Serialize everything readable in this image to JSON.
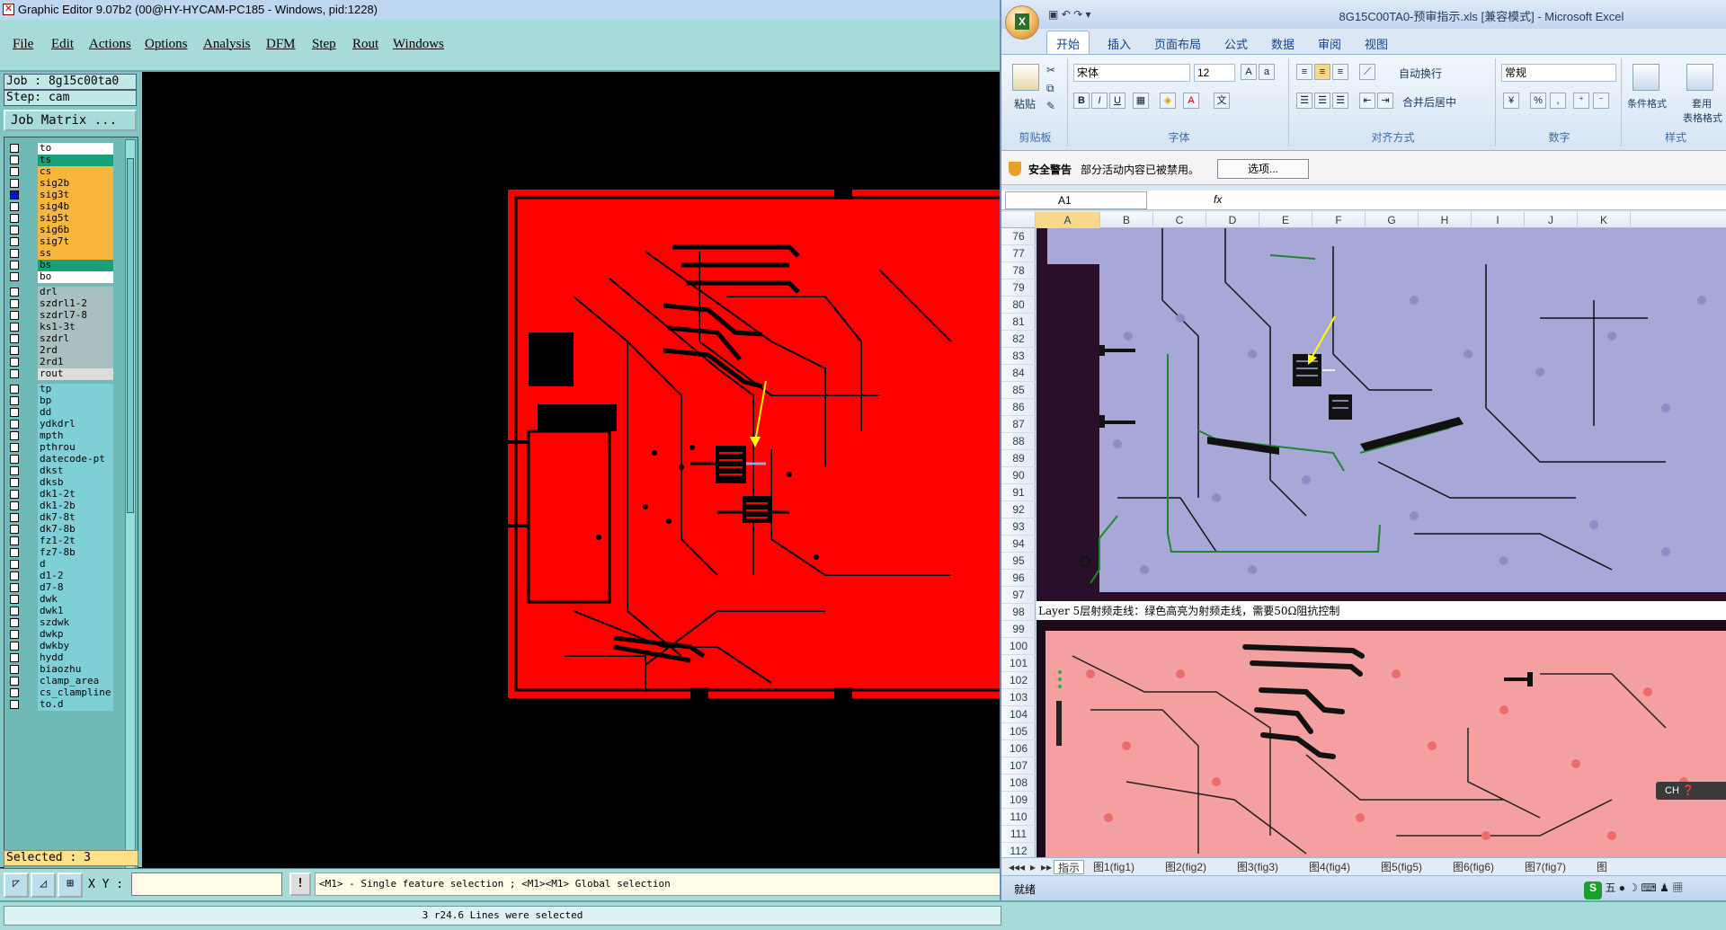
{
  "genesis": {
    "title": "Graphic Editor 9.07b2 (00@HY-HYCAM-PC185 - Windows, pid:1228)",
    "menu": [
      "File",
      "Edit",
      "Actions",
      "Options",
      "Analysis",
      "DFM",
      "Step",
      "Rout",
      "Windows"
    ],
    "job": "Job : 8g15c00ta0",
    "step": "Step: cam",
    "job_matrix": "Job Matrix ...",
    "layers_signal": [
      {
        "name": "to",
        "color": "#ffffff",
        "checked": false
      },
      {
        "name": "ts",
        "color": "#17a07a",
        "checked": false
      },
      {
        "name": "cs",
        "color": "#f6b73c",
        "checked": false
      },
      {
        "name": "sig2b",
        "color": "#f6b73c",
        "checked": false
      },
      {
        "name": "sig3t",
        "color": "#f6b73c",
        "checked": true
      },
      {
        "name": "sig4b",
        "color": "#f6b73c",
        "checked": false
      },
      {
        "name": "sig5t",
        "color": "#f6b73c",
        "checked": false
      },
      {
        "name": "sig6b",
        "color": "#f6b73c",
        "checked": false
      },
      {
        "name": "sig7t",
        "color": "#f6b73c",
        "checked": false
      },
      {
        "name": "ss",
        "color": "#f6b73c",
        "checked": false
      },
      {
        "name": "bs",
        "color": "#17a07a",
        "checked": false
      },
      {
        "name": "bo",
        "color": "#ffffff",
        "checked": false
      }
    ],
    "layers_drill": [
      "drl",
      "szdrl1-2",
      "szdrl7-8",
      "ks1-3t",
      "szdrl",
      "2rd",
      "2rd1",
      "rout"
    ],
    "layers_misc": [
      "tp",
      "bp",
      "dd",
      "ydkdrl",
      "mpth",
      "pthrou",
      "datecode-pt",
      "dkst",
      "dksb",
      "dk1-2t",
      "dk1-2b",
      "dk7-8t",
      "dk7-8b",
      "fz1-2t",
      "fz7-8b",
      "d",
      "d1-2",
      "d7-8",
      "dwk",
      "dwk1",
      "szdwk",
      "dwkp",
      "dwkby",
      "hydd",
      "biaozhu",
      "clamp_area",
      "cs_clampline",
      "to.d"
    ],
    "selected": "Selected : 3",
    "xy_label": "X Y :",
    "hint": "<M1> - Single feature selection ; <M1><M1> Global selection",
    "status": "3 r24.6 Lines were selected",
    "hint_icon": "!",
    "colors": {
      "board": "#ff0000",
      "highlight": "#ffff00",
      "bg": "#000000",
      "panel": "#7fc6c4"
    }
  },
  "excel": {
    "doc_title": "8G15C00TA0-预审指示.xls [兼容模式] - Microsoft Excel",
    "ribbon_tabs": [
      "开始",
      "插入",
      "页面布局",
      "公式",
      "数据",
      "审阅",
      "视图"
    ],
    "active_tab": "开始",
    "groups": {
      "clipboard": {
        "label": "剪贴板",
        "paste": "粘贴"
      },
      "font": {
        "label": "字体",
        "name": "宋体",
        "size": "12",
        "bold": "B",
        "italic": "I",
        "underline": "U"
      },
      "align": {
        "label": "对齐方式",
        "wrap": "自动换行",
        "merge": "合并后居中"
      },
      "number": {
        "label": "数字",
        "format": "常规",
        "percent": "%",
        "comma": ","
      },
      "styles": {
        "label": "样式",
        "cond": "条件格式",
        "table": "套用",
        "table2": "表格格式"
      }
    },
    "security": {
      "title": "安全警告",
      "message": "部分活动内容已被禁用。",
      "options": "选项..."
    },
    "namebox": "A1",
    "fx": "fx",
    "columns": [
      "A",
      "B",
      "C",
      "D",
      "E",
      "F",
      "G",
      "H",
      "I",
      "J",
      "K"
    ],
    "rows": [
      "76",
      "77",
      "78",
      "79",
      "80",
      "81",
      "82",
      "83",
      "84",
      "85",
      "86",
      "87",
      "88",
      "89",
      "90",
      "91",
      "92",
      "93",
      "94",
      "95",
      "96",
      "97",
      "98",
      "99",
      "100",
      "101",
      "102",
      "103",
      "104",
      "105",
      "106",
      "107",
      "108",
      "109",
      "110",
      "111",
      "112"
    ],
    "caption": "Layer 5层射频走线：绿色高亮为射频走线，需要50Ω阻抗控制",
    "sheets": [
      "指示",
      "图1(fig1)",
      "图2(fig2)",
      "图3(fig3)",
      "图4(fig4)",
      "图5(fig5)",
      "图6(fig6)",
      "图7(fig7)",
      "图"
    ],
    "status": "就绪",
    "ime_cn": "CH",
    "ime_label": "五",
    "ime_icons": [
      "●",
      "☽",
      "⌨",
      "♟",
      "▦"
    ]
  }
}
